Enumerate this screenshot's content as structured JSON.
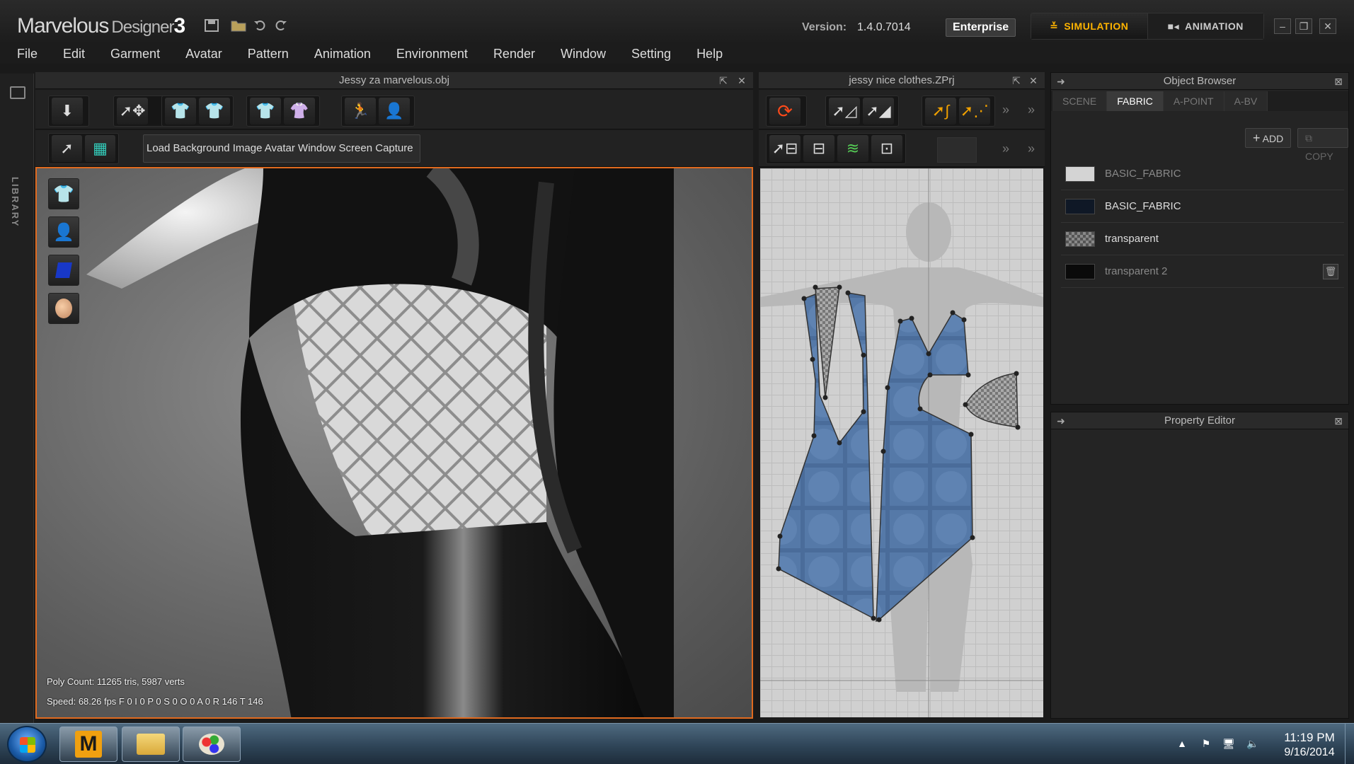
{
  "app": {
    "name": "Marvelous",
    "name_suffix": "Designer",
    "name_version": "3",
    "version_label": "Version:",
    "version_value": "1.4.0.7014",
    "edition": "Enterprise",
    "modes": {
      "simulation": "SIMULATION",
      "animation": "ANIMATION"
    }
  },
  "menu": [
    "File",
    "Edit",
    "Garment",
    "Avatar",
    "Pattern",
    "Animation",
    "Environment",
    "Render",
    "Window",
    "Setting",
    "Help"
  ],
  "library": {
    "label": "LIBRARY"
  },
  "view3d": {
    "title": "Jessy za marvelous.obj",
    "toolbar_button_label": "Load Background Image Avatar Window Screen Capture",
    "stats": {
      "poly": "Poly Count: 11265 tris, 5987 verts",
      "speed": "Speed: 68.26 fps F  0 I   0 P   0 S   0 O   0 A   0 R 146 T 146"
    }
  },
  "view2d": {
    "title": "jessy nice clothes.ZPrj"
  },
  "object_browser": {
    "title": "Object Browser",
    "tabs": [
      "SCENE",
      "FABRIC",
      "A-POINT",
      "A-BV"
    ],
    "active_tab": "FABRIC",
    "add_label": "ADD",
    "copy_label": "COPY",
    "fabrics": [
      {
        "name": "BASIC_FABRIC",
        "swatch": "#d4d4d4",
        "dim": true
      },
      {
        "name": "BASIC_FABRIC",
        "swatch": "#0f1826",
        "dim": false
      },
      {
        "name": "transparent",
        "swatch": "checker",
        "dim": false
      },
      {
        "name": "transparent 2",
        "swatch": "#0a0a0a",
        "dim": true
      }
    ]
  },
  "property_editor": {
    "title": "Property Editor"
  },
  "taskbar": {
    "time": "11:19 PM",
    "date": "9/16/2014"
  },
  "colors": {
    "accent": "#ffb400",
    "viewport_border": "#e06a1f",
    "pattern_blue": "#5579a8"
  }
}
